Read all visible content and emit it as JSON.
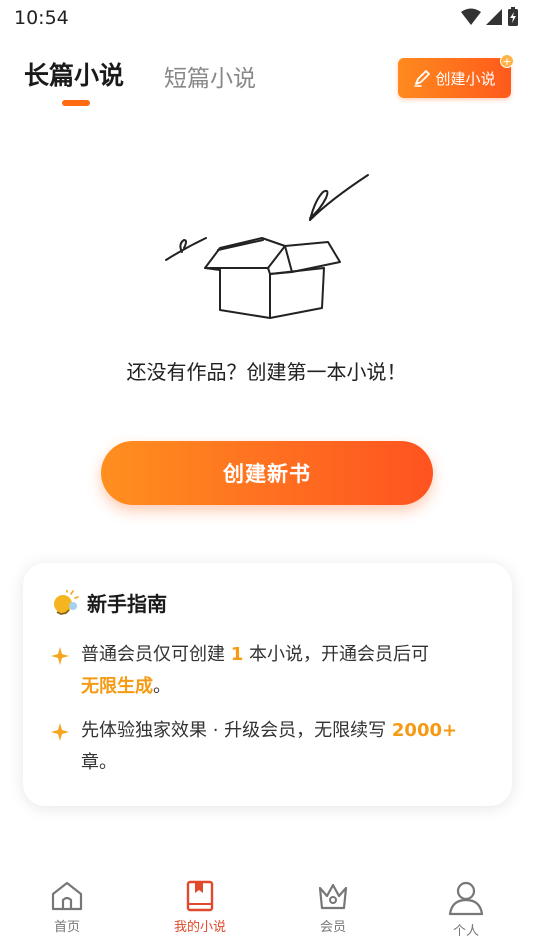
{
  "status_bar": {
    "time": "10:54"
  },
  "tabs": [
    {
      "label": "长篇小说",
      "active": true
    },
    {
      "label": "短篇小说",
      "active": false
    }
  ],
  "header": {
    "create_button_label": "创建小说",
    "plus": "+"
  },
  "empty_state": {
    "message": "还没有作品？创建第一本小说！"
  },
  "primary_action": {
    "label": "创建新书"
  },
  "guide": {
    "title": "新手指南",
    "item1": {
      "before": "普通会员仅可创建",
      "count": "1",
      "middle": "本小说，开通会员后可",
      "highlight": "无限生成",
      "after": "。"
    },
    "item2": {
      "before": "先体验独家效果 · 升级会员，无限续写",
      "highlight": "2000+",
      "after": "章。"
    }
  },
  "bottom_nav": [
    {
      "label": "首页",
      "icon": "home-icon",
      "active": false
    },
    {
      "label": "我的小说",
      "icon": "book-icon",
      "active": true
    },
    {
      "label": "会员",
      "icon": "crown-icon",
      "active": false
    },
    {
      "label": "个人",
      "icon": "person-icon",
      "active": false
    }
  ],
  "colors": {
    "accent": "#ff6a13",
    "highlight": "#f59a12",
    "nav_active": "#e0492a"
  }
}
